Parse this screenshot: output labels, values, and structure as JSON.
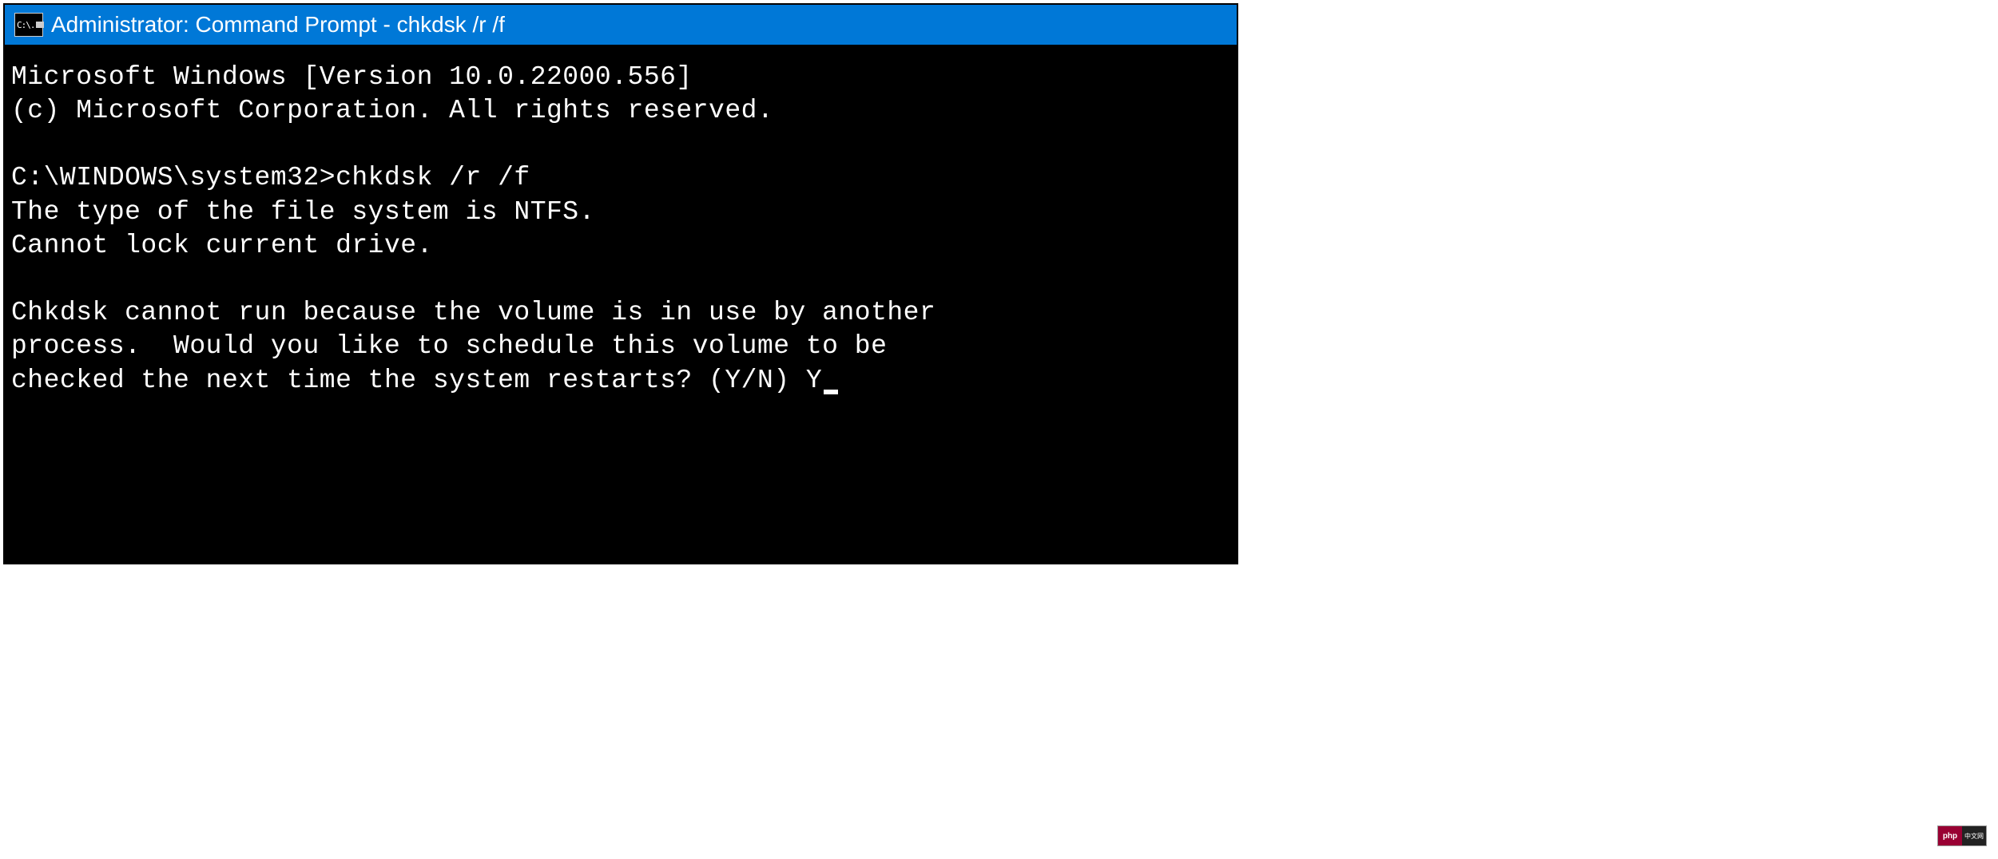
{
  "window": {
    "title": "Administrator: Command Prompt - chkdsk  /r /f",
    "icon_text": "C:\\"
  },
  "terminal": {
    "lines": [
      "Microsoft Windows [Version 10.0.22000.556]",
      "(c) Microsoft Corporation. All rights reserved.",
      "",
      "C:\\WINDOWS\\system32>chkdsk /r /f",
      "The type of the file system is NTFS.",
      "Cannot lock current drive.",
      "",
      "Chkdsk cannot run because the volume is in use by another",
      "process.  Would you like to schedule this volume to be",
      "checked the next time the system restarts? (Y/N) Y"
    ]
  },
  "watermark": {
    "left": "php",
    "right": "中文网"
  }
}
